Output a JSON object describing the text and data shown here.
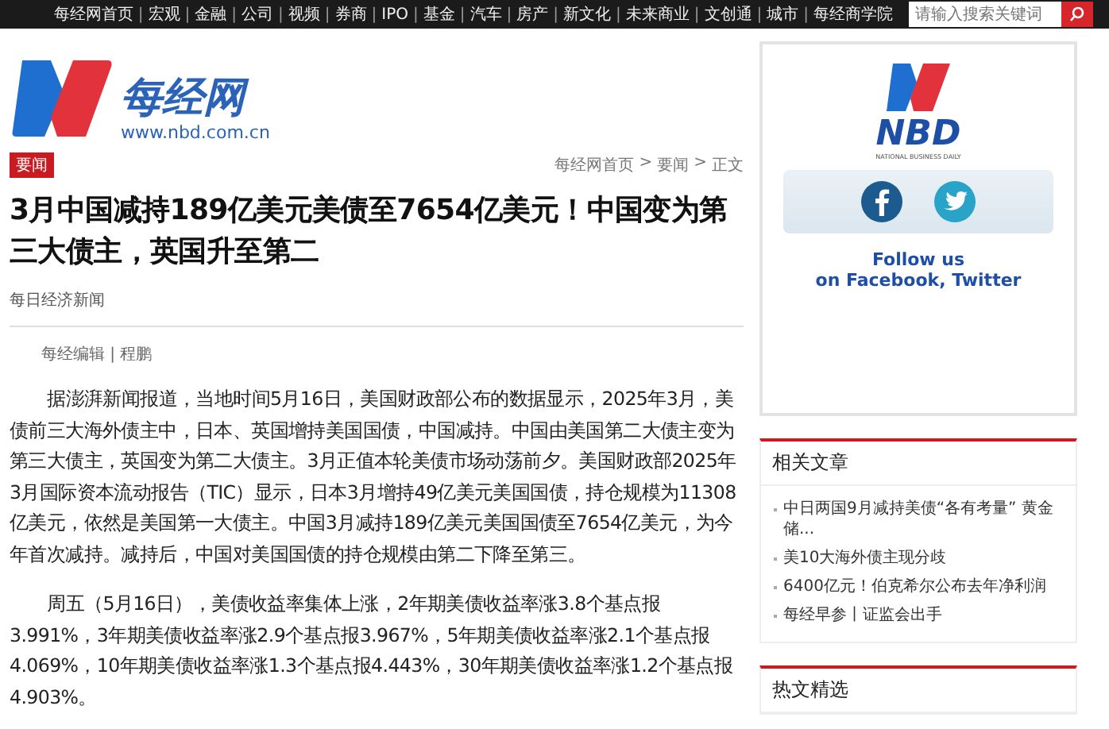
{
  "nav": {
    "items": [
      "每经网首页",
      "宏观",
      "金融",
      "公司",
      "视频",
      "券商",
      "IPO",
      "基金",
      "汽车",
      "房产",
      "新文化",
      "未来商业",
      "文创通",
      "城市",
      "每经商学院"
    ],
    "separator": "|",
    "search": {
      "placeholder": "请输入搜索关键词"
    }
  },
  "logo": {
    "name": "每经网",
    "url": "www.nbd.com.cn"
  },
  "tag": "要闻",
  "breadcrumb": {
    "items": [
      "每经网首页",
      "要闻",
      "正文"
    ],
    "separator": ">"
  },
  "title": "3月中国减持189亿美元美债至7654亿美元！中国变为第三大债主，英国升至第二",
  "source": "每日经济新闻",
  "editor": "每经编辑 | 程鹏",
  "paragraphs": [
    "据澎湃新闻报道，当地时间5月16日，美国财政部公布的数据显示，2025年3月，美债前三大海外债主中，日本、英国增持美国国债，中国减持。中国由美国第二大债主变为第三大债主，英国变为第二大债主。3月正值本轮美债市场动荡前夕。美国财政部2025年3月国际资本流动报告（TIC）显示，日本3月增持49亿美元美国国债，持仓规模为11308亿美元，依然是美国第一大债主。中国3月减持189亿美元美国国债至7654亿美元，为今年首次减持。减持后，中国对美国国债的持仓规模由第二下降至第三。",
    "周五（5月16日），美债收益率集体上涨，2年期美债收益率涨3.8个基点报3.991%，3年期美债收益率涨2.9个基点报3.967%，5年期美债收益率涨2.1个基点报4.069%，10年期美债收益率涨1.3个基点报4.443%，30年期美债收益率涨1.2个基点报4.903%。"
  ],
  "sidebar": {
    "promo": {
      "brand": "NBD",
      "tagline": "NATIONAL BUSINESS DAILY",
      "follow": [
        "Follow us",
        "on Facebook, Twitter"
      ]
    },
    "sections": [
      {
        "title": "相关文章",
        "items": [
          "中日两国9月减持美债“各有考量” 黄金储...",
          "美10大海外债主现分歧",
          "6400亿元！伯克希尔公布去年净利润",
          "每经早参丨证监会出手"
        ]
      },
      {
        "title": "热文精选"
      }
    ]
  }
}
